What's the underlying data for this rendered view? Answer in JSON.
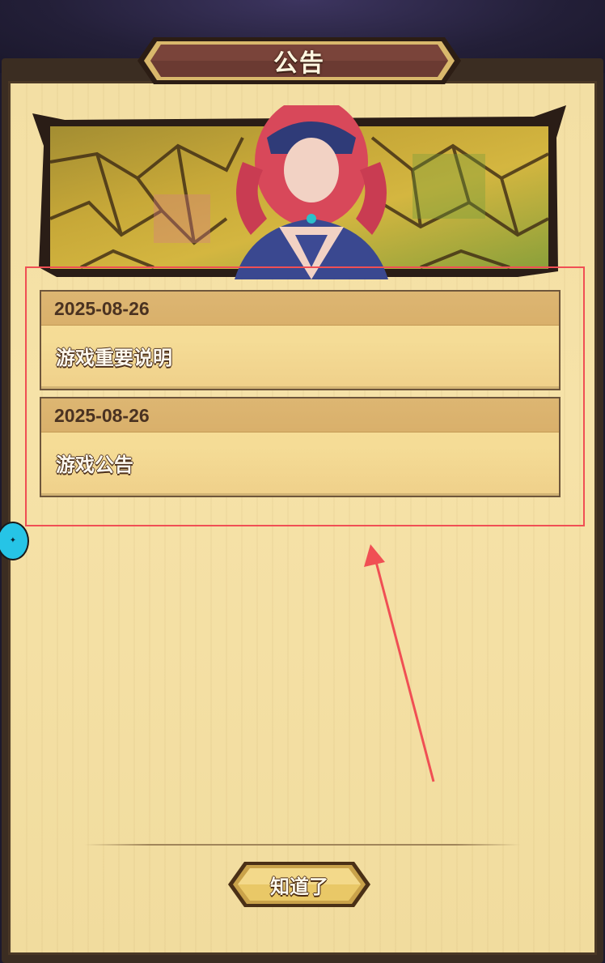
{
  "dialog": {
    "title": "公告"
  },
  "notices": [
    {
      "date": "2025-08-26",
      "title": "游戏重要说明"
    },
    {
      "date": "2025-08-26",
      "title": "游戏公告"
    }
  ],
  "footer": {
    "confirm_label": "知道了"
  },
  "side_badge": {
    "icon": "float-assistant-icon"
  },
  "colors": {
    "panel_bg": "#f3dfa4",
    "date_bar": "#ddb672",
    "title_plate": "#6b3a32",
    "highlight": "#f04f54",
    "button_gold": "#e9c867"
  }
}
